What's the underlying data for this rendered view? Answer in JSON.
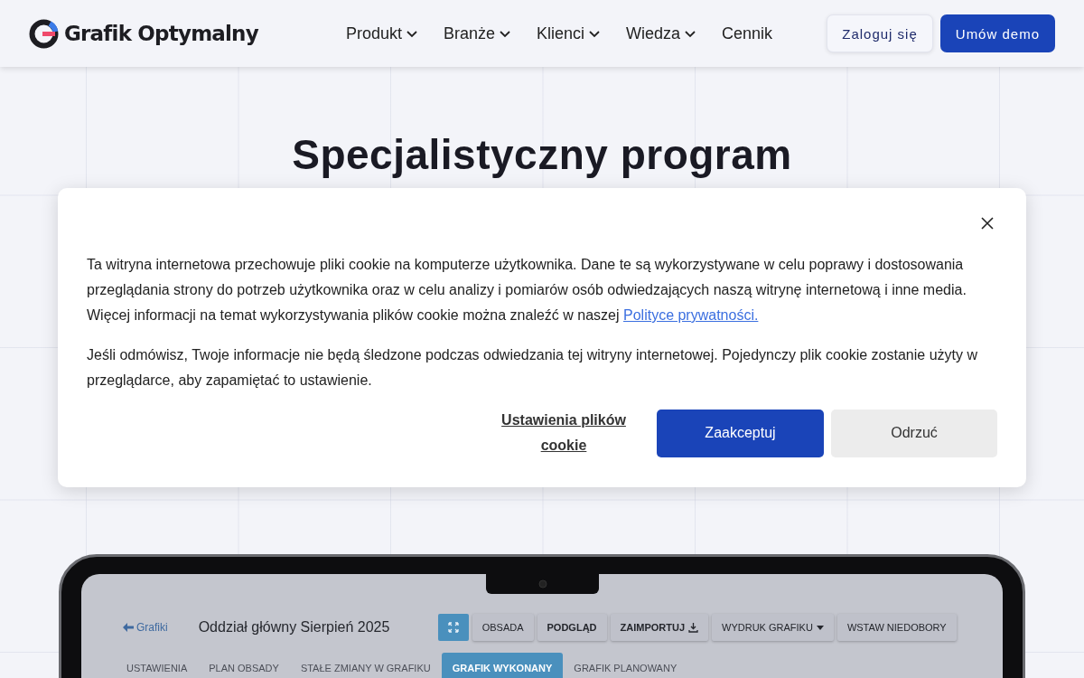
{
  "header": {
    "logo_text": "Grafik Optymalny",
    "nav": [
      {
        "label": "Produkt",
        "has_menu": true
      },
      {
        "label": "Branże",
        "has_menu": true
      },
      {
        "label": "Klienci",
        "has_menu": true
      },
      {
        "label": "Wiedza",
        "has_menu": true
      },
      {
        "label": "Cennik",
        "has_menu": false
      }
    ],
    "login": "Zaloguj się",
    "demo": "Umów demo"
  },
  "hero": {
    "heading": "Specjalistyczny program"
  },
  "cookie_dialog": {
    "paragraph_1": "Ta witryna internetowa przechowuje pliki cookie na komputerze użytkownika. Dane te są wykorzystywane w celu poprawy i dostosowania przeglądania strony do potrzeb użytkownika oraz w celu analizy i pomiarów osób odwiedzających naszą witrynę internetową i inne media. Więcej informacji na temat wykorzystywania plików cookie można znaleźć w naszej ",
    "privacy_link": "Polityce prywatności.",
    "paragraph_2": "Jeśli odmówisz, Twoje informacje nie będą śledzone podczas odwiedzania tej witryny internetowej. Pojedynczy plik cookie zostanie użyty w przeglądarce, aby zapamiętać to ustawienie.",
    "settings_link": "Ustawienia plików cookie",
    "accept": "Zaakceptuj",
    "reject": "Odrzuć"
  },
  "app_preview": {
    "back_link": "Grafiki",
    "title": "Oddział główny Sierpień 2025",
    "toolbar": [
      {
        "kind": "icon"
      },
      {
        "kind": "text",
        "label": "OBSADA",
        "bold": false
      },
      {
        "kind": "text",
        "label": "PODGLĄD",
        "bold": true
      },
      {
        "kind": "import",
        "label": "ZAIMPORTUJ",
        "bold": true
      },
      {
        "kind": "dropdown",
        "label": "WYDRUK GRAFIKU",
        "bold": false
      },
      {
        "kind": "text",
        "label": "WSTAW NIEDOBORY",
        "bold": false
      }
    ],
    "tabs": [
      {
        "label": "USTAWIENIA",
        "selected": false
      },
      {
        "label": "PLAN OBSADY",
        "selected": false
      },
      {
        "label": "STAŁE ZMIANY W GRAFIKU",
        "selected": false
      },
      {
        "label": "GRAFIK WYKONANY",
        "selected": true
      },
      {
        "label": "GRAFIK PLANOWANY",
        "selected": false
      }
    ]
  }
}
